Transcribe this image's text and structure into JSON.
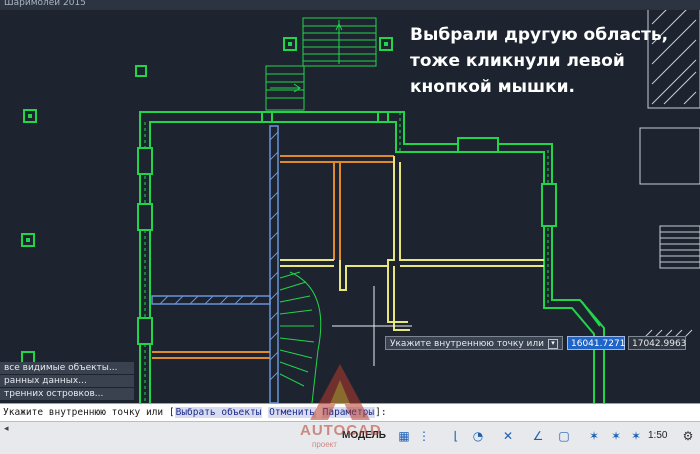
{
  "window": {
    "title": "Шаримолей 2015"
  },
  "annotation": {
    "text": "Выбрали другую область,\nтоже кликнули левой\nкнопкой мышки."
  },
  "cursor_tooltip": {
    "prompt": "Укажите внутреннюю точку или",
    "coord_x": "16041.7271",
    "coord_y": "17042.9963"
  },
  "history": [
    "все видимые объекты...",
    "ранных данных...",
    "тренних островков..."
  ],
  "command_line": {
    "prompt": "Укажите внутреннюю точку или [",
    "options": [
      "Выбрать объекты",
      "Отменить",
      "Параметры"
    ],
    "close": "]:"
  },
  "statusbar": {
    "model_label": "МОДЕЛЬ",
    "scale": "1:50",
    "left_text": "◂",
    "icons": [
      "grid-icon",
      "snap-icon",
      "ortho-icon",
      "polar-icon",
      "osnap-icon",
      "otrack-icon",
      "lineweight-icon",
      "annotation-scale-icon",
      "workspace-icon",
      "settings-icon"
    ]
  },
  "watermark": {
    "brand": "AUTOCAD",
    "sub": "проект"
  },
  "colors": {
    "background": "#1d2430",
    "wall_green": "#22d44a",
    "yellow": "#e6e67a",
    "orange": "#e08a2c",
    "blue_hatch": "#6a93d8"
  }
}
